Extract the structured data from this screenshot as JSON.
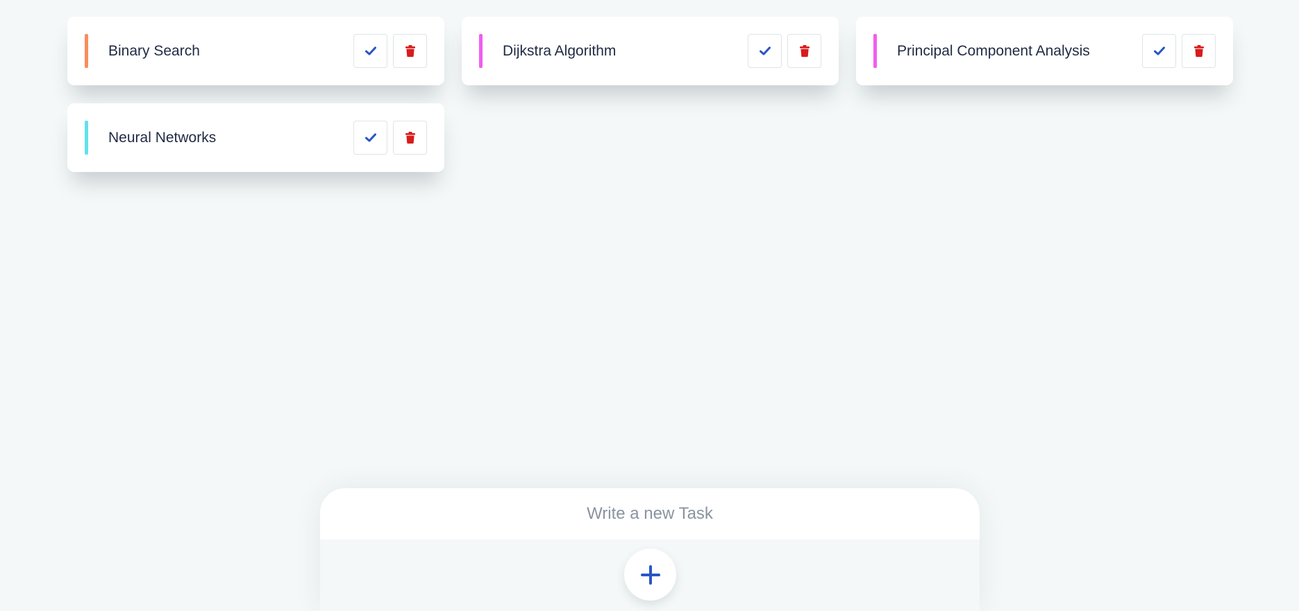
{
  "tasks": [
    {
      "title": "Binary Search",
      "accent": "#fb8c5c"
    },
    {
      "title": "Dijkstra Algorithm",
      "accent": "#f25cf0"
    },
    {
      "title": "Principal Component Analysis",
      "accent": "#f25cf0"
    },
    {
      "title": "Neural Networks",
      "accent": "#62e0ee"
    }
  ],
  "icons": {
    "complete": "check-icon",
    "delete": "trash-icon",
    "add": "plus-icon"
  },
  "colors": {
    "check": "#2a55c8",
    "delete": "#d91b1b",
    "add": "#2a55c8"
  },
  "composer": {
    "placeholder": "Write a new Task",
    "value": ""
  }
}
